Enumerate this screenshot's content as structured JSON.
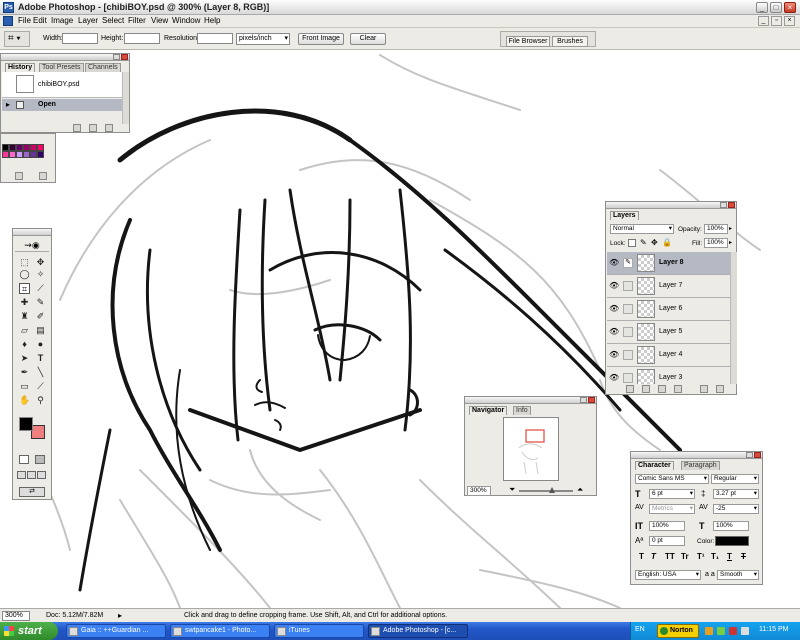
{
  "window": {
    "title": "Adobe Photoshop - [chibiBOY.psd @ 300% (Layer 8, RGB)]",
    "controls": [
      "_",
      "□",
      "×"
    ]
  },
  "menu": [
    "File",
    "Edit",
    "Image",
    "Layer",
    "Select",
    "Filter",
    "View",
    "Window",
    "Help"
  ],
  "options_bar": {
    "width_label": "Width:",
    "height_label": "Height:",
    "resolution_label": "Resolution:",
    "units_select": "pixels/inch",
    "front_image_button": "Front Image",
    "clear_button": "Clear",
    "well_tabs": [
      "File Browser",
      "Brushes"
    ]
  },
  "history_palette": {
    "tabs": [
      "History",
      "Tool Presets",
      "Channels"
    ],
    "snapshot_name": "chibiBOY.psd",
    "state": "Open"
  },
  "swatch_colors": [
    "#000000",
    "#330033",
    "#660066",
    "#990066",
    "#cc0066",
    "#ff0066",
    "#ff3399",
    "#ff66cc",
    "#cc99ff",
    "#9966cc",
    "#663399",
    "#330066"
  ],
  "layers_palette": {
    "tab": "Layers",
    "blend_mode": "Normal",
    "opacity_label": "Opacity:",
    "opacity": "100%",
    "lock_label": "Lock:",
    "fill_label": "Fill:",
    "fill": "100%",
    "layers": [
      "Layer 8",
      "Layer 7",
      "Layer 6",
      "Layer 5",
      "Layer 4",
      "Layer 3"
    ],
    "selected": "Layer 8"
  },
  "navigator_palette": {
    "tabs": [
      "Navigator",
      "Info"
    ],
    "zoom": "300%"
  },
  "character_palette": {
    "tabs": [
      "Character",
      "Paragraph"
    ],
    "font_family": "Comic Sans MS",
    "font_style": "Regular",
    "font_size": "6 pt",
    "leading": "3.27 pt",
    "kerning": "Metrics",
    "tracking": "-25",
    "vertical_scale": "100%",
    "horizontal_scale": "100%",
    "baseline_shift": "0 pt",
    "color_label": "Color:",
    "text_color": "#000000",
    "type_buttons": [
      "T",
      "T",
      "TT",
      "Tr",
      "T¹",
      "T₁",
      "T",
      "T"
    ],
    "language": "English: USA",
    "aa_label": "a a",
    "antialias": "Smooth"
  },
  "toolbox": {
    "foreground_color": "#000000",
    "background_color": "#f08080"
  },
  "status_bar": {
    "zoom": "300%",
    "doc_size": "Doc: 5.12M/7.82M",
    "hint": "Click and drag to define cropping frame. Use Shift, Alt, and Ctrl for additional options."
  },
  "taskbar": {
    "start_label": "start",
    "tasks": [
      "Gaia :: ++Guardian ...",
      "swtpancake1 - Photo...",
      "iTunes",
      "Adobe Photoshop - [c..."
    ],
    "active_task": "Adobe Photoshop - [c...",
    "language": "EN",
    "norton_label": "Norton",
    "clock": "11:15 PM"
  }
}
